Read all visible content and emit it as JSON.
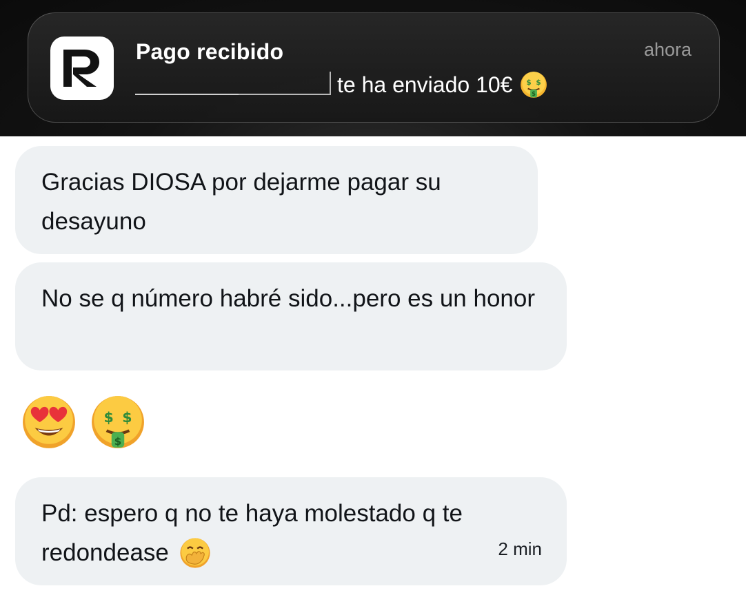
{
  "notification": {
    "app_icon_letter": "R",
    "title": "Pago recibido",
    "time": "ahora",
    "body": "te ha enviado 10€",
    "body_emoji": "money-mouth-face-icon"
  },
  "messages": [
    {
      "text": "Gracias DIOSA por dejarme pagar su desayuno"
    },
    {
      "text": "No se q número habré sido...pero es un honor"
    },
    {
      "emojis": [
        "heart-eyes-face-icon",
        "money-mouth-face-icon"
      ]
    },
    {
      "line1": "Pd: espero q no te haya molestado q te",
      "line2": "redondease",
      "emoji": "face-with-hand-over-mouth-icon",
      "time": "2 min"
    }
  ]
}
